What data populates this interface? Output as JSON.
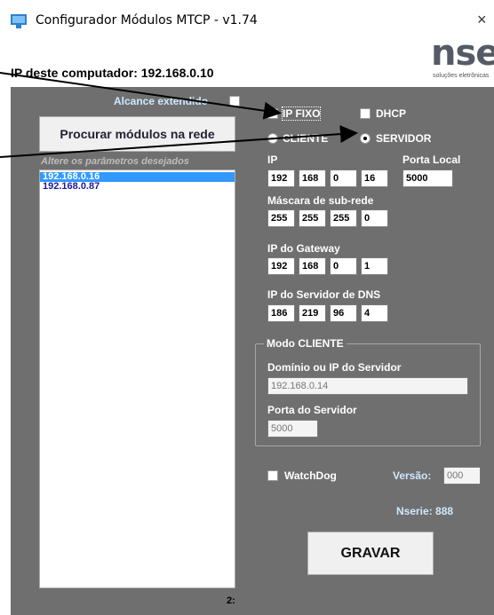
{
  "window": {
    "title": "Configurador Módulos MTCP - v1.74",
    "close_glyph": "×"
  },
  "logo": {
    "main": "nse",
    "sub": "soluções eletrônicas"
  },
  "ip_label": "IP deste computador: 192.168.0.10",
  "alcance_label": "Alcance extendido",
  "search_button": "Procurar módulos na rede",
  "list_hint": "Altere os parâmetros desejados",
  "modules": [
    "192.168.0.16",
    "192.168.0.87"
  ],
  "list_count": "2:",
  "ip_mode": {
    "fixo": "IP FIXO",
    "dhcp": "DHCP"
  },
  "role": {
    "cliente": "CLIENTE",
    "servidor": "SERVIDOR"
  },
  "ip": {
    "label": "IP",
    "octets": [
      "192",
      "168",
      "0",
      "16"
    ]
  },
  "porta_local": {
    "label": "Porta Local",
    "value": "5000"
  },
  "mascara": {
    "label": "Máscara de sub-rede",
    "octets": [
      "255",
      "255",
      "255",
      "0"
    ]
  },
  "gateway": {
    "label": "IP do Gateway",
    "octets": [
      "192",
      "168",
      "0",
      "1"
    ]
  },
  "dns": {
    "label": "IP do Servidor de DNS",
    "octets": [
      "186",
      "219",
      "96",
      "4"
    ]
  },
  "modo_cliente": {
    "title": "Modo CLIENTE",
    "dominio_label": "Domínio ou IP do Servidor",
    "dominio_value": "192.168.0.14",
    "porta_label": "Porta do Servidor",
    "porta_value": "5000"
  },
  "watchdog": {
    "label": "WatchDog"
  },
  "versao": {
    "label": "Versão:",
    "value": "000"
  },
  "nserie": "Nserie: 888",
  "gravar_button": "GRAVAR",
  "colors": {
    "panel": "#6f6f6f",
    "selection": "#3399ff",
    "list_text": "#1a1aa0",
    "arrow": "#000000"
  }
}
